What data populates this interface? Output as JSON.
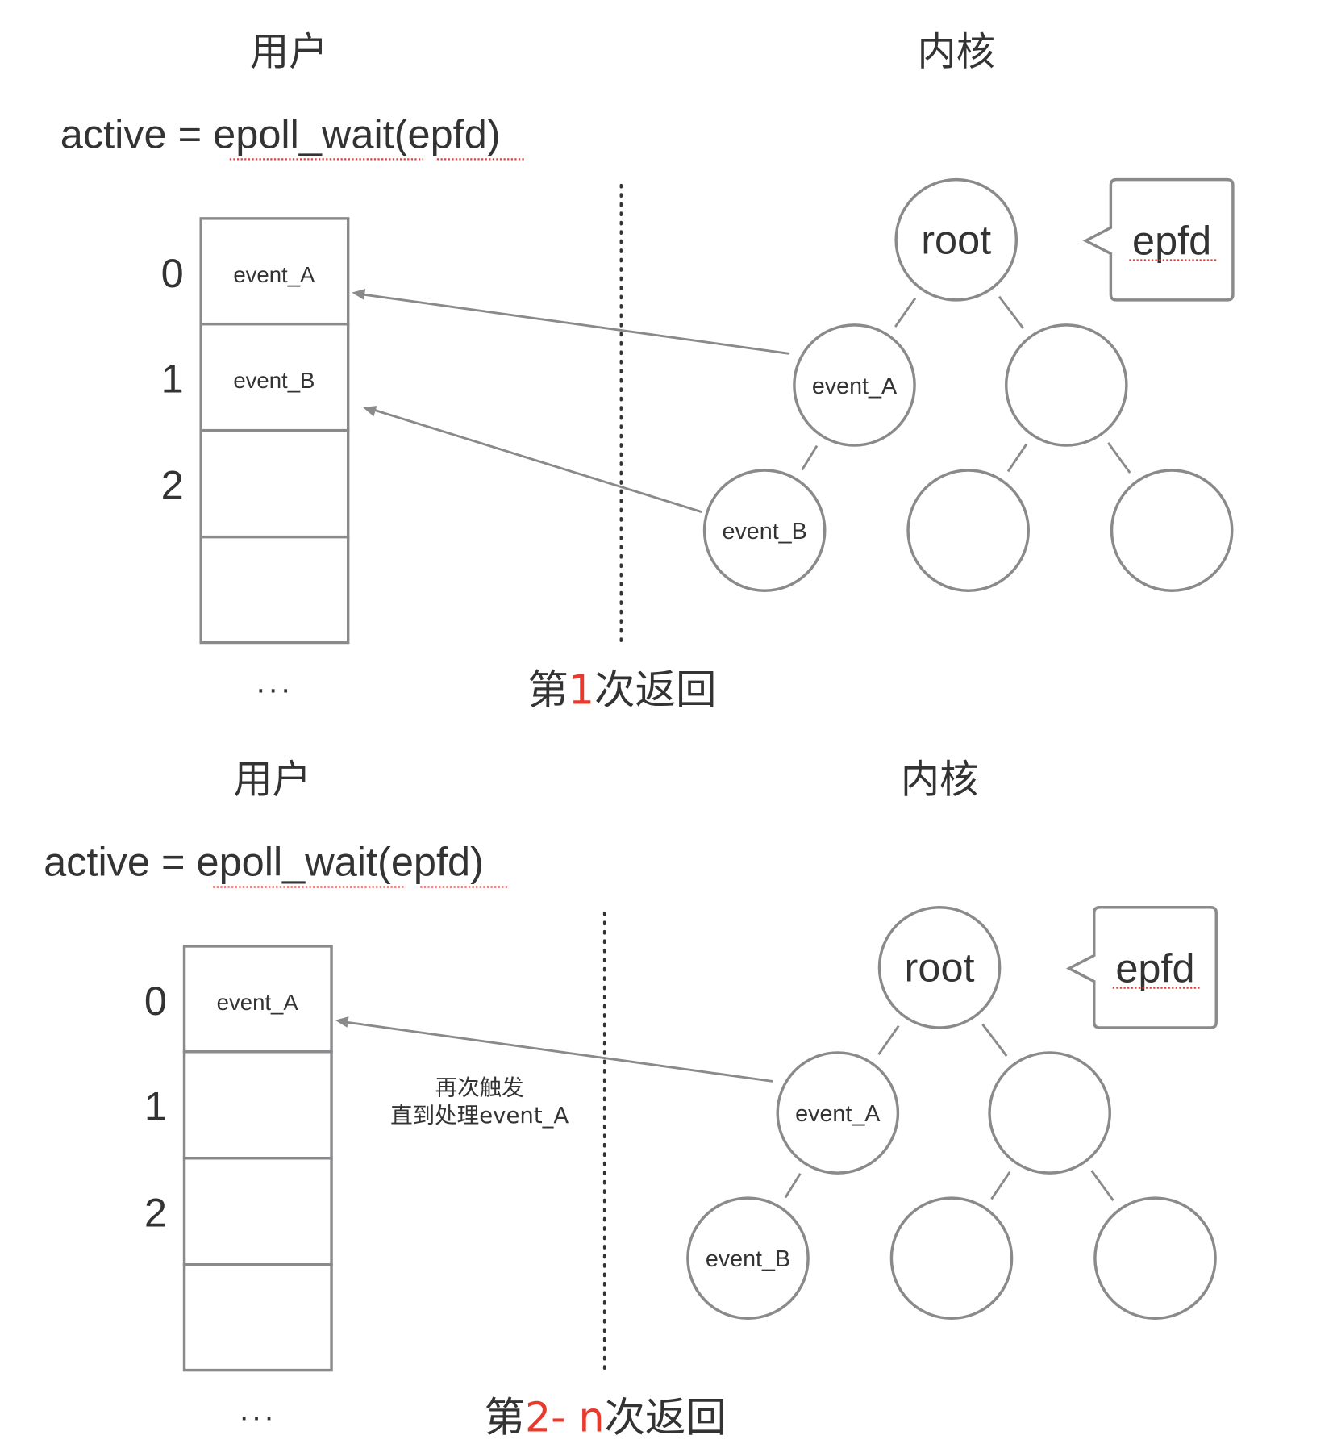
{
  "panels": [
    {
      "user_label": "用户",
      "kernel_label": "内核",
      "call": {
        "prefix": "active = ",
        "func": "epoll_wait",
        "open": "(",
        "arg": "epfd",
        "close": ")"
      },
      "array": {
        "indices": [
          "0",
          "1",
          "2"
        ],
        "slots": [
          "event_A",
          "event_B",
          "",
          ""
        ],
        "ellipsis": "..."
      },
      "tree": {
        "root": "root",
        "nodes": [
          "event_A",
          "",
          "event_B",
          "",
          ""
        ]
      },
      "callout": "epfd",
      "arrows": [
        {
          "from": "event_A",
          "to_slot": 0
        },
        {
          "from": "event_B",
          "to_slot": 1
        }
      ],
      "note": [],
      "caption": [
        {
          "text": "第",
          "highlight": false
        },
        {
          "text": "1",
          "highlight": true
        },
        {
          "text": "次返回",
          "highlight": false
        }
      ]
    },
    {
      "user_label": "用户",
      "kernel_label": "内核",
      "call": {
        "prefix": "active = ",
        "func": "epoll_wait",
        "open": "(",
        "arg": "epfd",
        "close": ")"
      },
      "array": {
        "indices": [
          "0",
          "1",
          "2"
        ],
        "slots": [
          "event_A",
          "",
          "",
          ""
        ],
        "ellipsis": "..."
      },
      "tree": {
        "root": "root",
        "nodes": [
          "event_A",
          "",
          "event_B",
          "",
          ""
        ]
      },
      "callout": "epfd",
      "arrows": [
        {
          "from": "event_A",
          "to_slot": 0
        }
      ],
      "note": [
        "再次触发",
        "直到处理event_A"
      ],
      "caption": [
        {
          "text": "第",
          "highlight": false
        },
        {
          "text": "2- n",
          "highlight": true
        },
        {
          "text": "次返回",
          "highlight": false
        }
      ]
    }
  ],
  "colors": {
    "stroke": "#8a8a8c",
    "text": "#333333",
    "highlight": "#e8392b",
    "squiggle": "#e04040"
  }
}
